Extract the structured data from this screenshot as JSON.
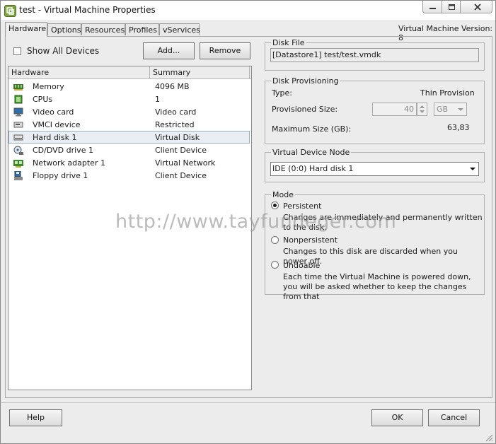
{
  "window": {
    "title": "test - Virtual Machine Properties"
  },
  "tabs": [
    {
      "label": "Hardware",
      "active": true
    },
    {
      "label": "Options",
      "active": false
    },
    {
      "label": "Resources",
      "active": false
    },
    {
      "label": "Profiles",
      "active": false
    },
    {
      "label": "vServices",
      "active": false
    }
  ],
  "vm_version": "Virtual Machine Version: 8",
  "hardware": {
    "show_all_label": "Show All Devices",
    "show_all_checked": false,
    "add_label": "Add...",
    "remove_label": "Remove",
    "columns": [
      "Hardware",
      "Summary"
    ],
    "rows": [
      {
        "icon": "memory-icon",
        "name": "Memory",
        "summary": "4096 MB",
        "selected": false
      },
      {
        "icon": "cpu-icon",
        "name": "CPUs",
        "summary": "1",
        "selected": false
      },
      {
        "icon": "video-card-icon",
        "name": "Video card",
        "summary": "Video card",
        "selected": false
      },
      {
        "icon": "vmci-device-icon",
        "name": "VMCI device",
        "summary": "Restricted",
        "selected": false
      },
      {
        "icon": "hard-disk-icon",
        "name": "Hard disk 1",
        "summary": "Virtual Disk",
        "selected": true
      },
      {
        "icon": "cd-dvd-icon",
        "name": "CD/DVD drive 1",
        "summary": "Client Device",
        "selected": false
      },
      {
        "icon": "network-adapter-icon",
        "name": "Network adapter 1",
        "summary": "Virtual Network",
        "selected": false
      },
      {
        "icon": "floppy-drive-icon",
        "name": "Floppy drive 1",
        "summary": "Client Device",
        "selected": false
      }
    ]
  },
  "disk_file": {
    "title": "Disk File",
    "value": "[Datastore1] test/test.vmdk"
  },
  "disk_provisioning": {
    "title": "Disk Provisioning",
    "type_label": "Type:",
    "type_value": "Thin Provision",
    "provisioned_label": "Provisioned Size:",
    "provisioned_value": "40",
    "provisioned_unit": "GB",
    "max_label": "Maximum Size (GB):",
    "max_value": "63,83"
  },
  "device_node": {
    "title": "Virtual Device Node",
    "selected": "IDE (0:0) Hard disk 1"
  },
  "mode": {
    "title": "Mode",
    "options": [
      {
        "label": "Persistent",
        "desc": "Changes are immediately and permanently written to the disk.",
        "selected": true
      },
      {
        "label": "Nonpersistent",
        "desc": "Changes to this disk are discarded when you power off.",
        "selected": false
      },
      {
        "label": "Undoable",
        "desc": "Each time the Virtual Machine is powered down, you will be asked whether to keep the changes from that",
        "selected": false
      }
    ]
  },
  "watermark": "http://www.tayfundeger.com",
  "footer": {
    "help_label": "Help",
    "ok_label": "OK",
    "cancel_label": "Cancel"
  },
  "colors": {
    "window_bg": "#ececec",
    "selection_bg": "#e9eef5",
    "selection_border": "#9aacc6",
    "app_icon": "#7fa342"
  }
}
